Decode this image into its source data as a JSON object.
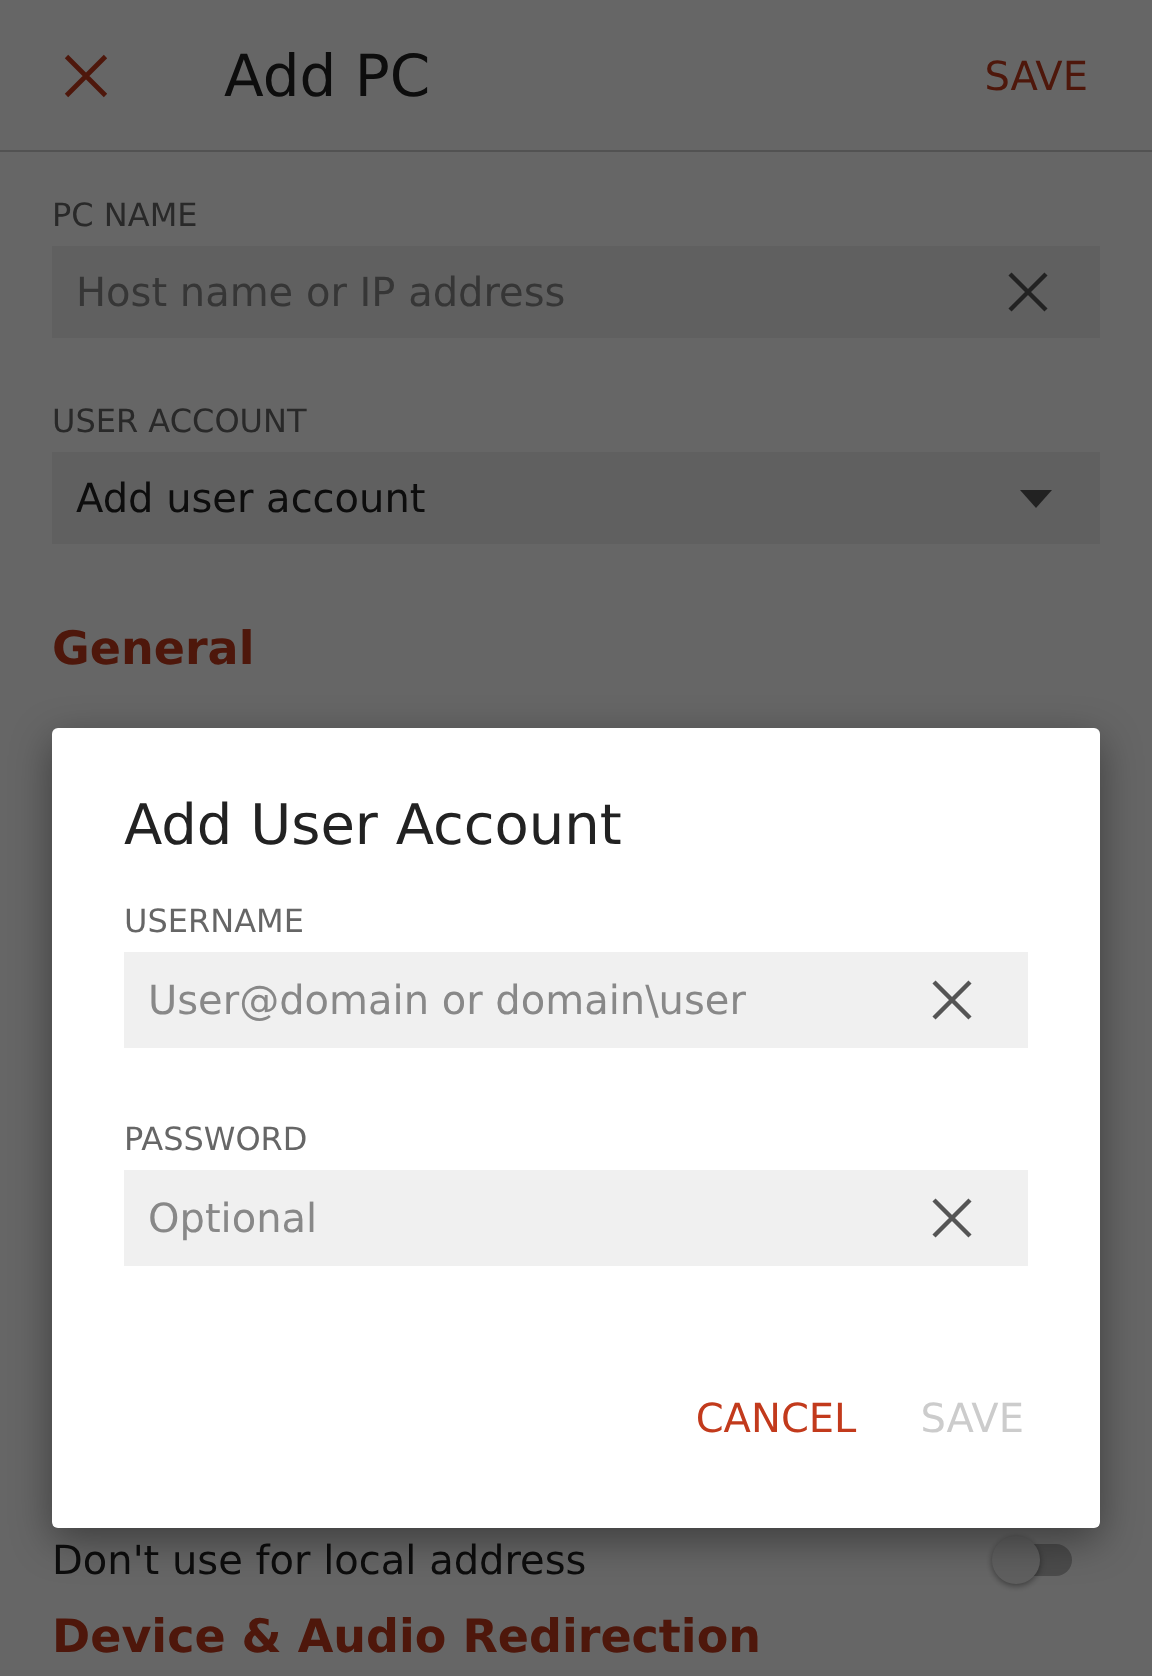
{
  "header": {
    "title": "Add PC",
    "save": "SAVE",
    "save_disabled": false
  },
  "fields": [
    {
      "label": "PC NAME",
      "kind": "text",
      "placeholder": "Host name or IP address"
    },
    {
      "label": "USER ACCOUNT",
      "kind": "dropdown",
      "value": "Add user account"
    }
  ],
  "sections": [
    {
      "title": "General"
    }
  ],
  "settings": [
    {
      "label": "Don't use for local address",
      "on": false
    }
  ],
  "sections_below": [
    {
      "title": "Device & Audio Redirection"
    }
  ],
  "dialog": {
    "title": "Add User Account",
    "fields": [
      {
        "label": "USERNAME",
        "placeholder": "User@domain or domain\\user"
      },
      {
        "label": "PASSWORD",
        "placeholder": "Optional"
      }
    ],
    "buttons": [
      {
        "label": "CANCEL",
        "disabled": false
      },
      {
        "label": "SAVE",
        "disabled": true
      }
    ]
  }
}
